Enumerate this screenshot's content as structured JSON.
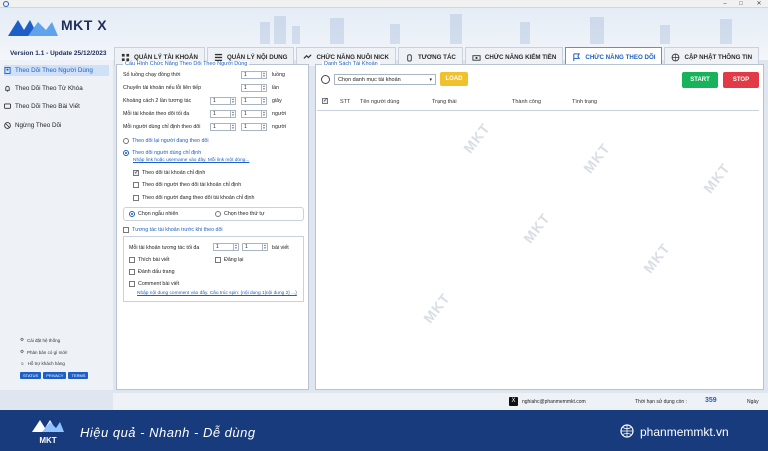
{
  "app": {
    "name": "MKT X",
    "version": "Version 1.1 - Update 25/12/2023"
  },
  "colors": {
    "accent": "#1c5fc7",
    "start": "#17b35a",
    "stop": "#e23a46",
    "load": "#f0c12a",
    "footer": "#183b7e"
  },
  "tabs": [
    {
      "label": "QUẢN LÝ TÀI KHOẢN",
      "icon": "grid-icon"
    },
    {
      "label": "QUẢN LÝ NỘI DUNG",
      "icon": "list-icon"
    },
    {
      "label": "CHỨC NĂNG NUÔI NICK",
      "icon": "handshake-icon"
    },
    {
      "label": "TƯƠNG TÁC",
      "icon": "hand-icon"
    },
    {
      "label": "CHỨC NĂNG KIẾM TIỀN",
      "icon": "money-icon"
    },
    {
      "label": "CHỨC NĂNG THEO DÕI",
      "icon": "flag-icon"
    },
    {
      "label": "CẬP NHẬT THÔNG TIN",
      "icon": "globe-icon"
    }
  ],
  "sidebar": {
    "items": [
      {
        "label": "Theo Dõi Theo Người Dùng",
        "icon": "user-icon"
      },
      {
        "label": "Theo Dõi Theo Từ Khóa",
        "icon": "bell-icon"
      },
      {
        "label": "Theo Dõi Theo Bài Viết",
        "icon": "chat-icon"
      },
      {
        "label": "Ngừng Theo Dõi",
        "icon": "stop-icon"
      }
    ],
    "bottom": [
      {
        "label": "Cài đặt hệ thống",
        "icon": "gear-icon"
      },
      {
        "label": "Phản bản có gì mới!",
        "icon": "gear-icon"
      },
      {
        "label": "Hỗ trợ khách hàng",
        "icon": "support-icon"
      }
    ],
    "chips": [
      "STATUS",
      "PRIVACY",
      "TERMS"
    ]
  },
  "config": {
    "title": "Cấu Hình Chức Năng Theo Dõi Theo Người Dùng",
    "fields": [
      {
        "label": "Số luồng chạy đồng thời",
        "v1": "1",
        "unit": "luồng"
      },
      {
        "label": "Chuyển tài khoản nếu lỗi liên tiếp",
        "v1": "1",
        "unit": "lần"
      },
      {
        "label": "Khoảng cách 2 lần tương tác",
        "v1": "1",
        "v2": "1",
        "unit": "giây"
      },
      {
        "label": "Mỗi tài khoản theo dõi tối đa",
        "v1": "1",
        "v2": "1",
        "unit": "người"
      },
      {
        "label": "Mỗi người dùng chỉ định theo dõi",
        "v1": "1",
        "v2": "1",
        "unit": "người"
      }
    ],
    "radio_follow_back": "Theo dõi lại người đang theo dõi",
    "radio_follow_specific": "Theo dõi người dùng chỉ định",
    "link_specific": "Nhập link hoặc username vào đây. Mỗi link một dòng...",
    "checks": [
      {
        "label": "Theo dõi tài khoản chỉ định",
        "checked": true
      },
      {
        "label": "Theo dõi người theo dõi tài khoản chỉ định",
        "checked": false
      },
      {
        "label": "Theo dõi người đang theo dõi tài khoản chỉ định",
        "checked": false
      }
    ],
    "random_label": "Chọn ngẫu nhiên",
    "order_label": "Chọn theo thứ tự",
    "interact_title": "Tương tác tài khoản trước khi theo dõi",
    "interact_max_label": "Mỗi tài khoản tương tác tối đa",
    "interact_v1": "1",
    "interact_v2": "1",
    "interact_unit": "bài viết",
    "like_label": "Thích bài viết",
    "repost_label": "Đăng lại",
    "bookmark_label": "Đánh dấu trang",
    "comment_label": "Comment bài viết",
    "comment_link": "Nhập nội dung comment vào đây. Cấu trúc spin: {nội dung 1|nội dung 2} ...}"
  },
  "accounts": {
    "title": "Danh Sách Tài Khoản",
    "select_value": "Chọn danh mục tài khoản",
    "load_label": "LOAD",
    "start_label": "START",
    "stop_label": "STOP",
    "columns": [
      "STT",
      "Tên người dùng",
      "Trạng thái",
      "Thành công",
      "Tình trạng"
    ]
  },
  "status": {
    "email": "nghiahc@phanmemmkt.com",
    "expiry_label": "Thời hạn sử dụng còn :",
    "days": "359",
    "days_unit": "Ngày"
  },
  "footer": {
    "slogan": "Hiệu quả - Nhanh - Dễ dùng",
    "site": "phanmemmkt.vn",
    "logo_text": "MKT"
  },
  "watermark": "MKT"
}
